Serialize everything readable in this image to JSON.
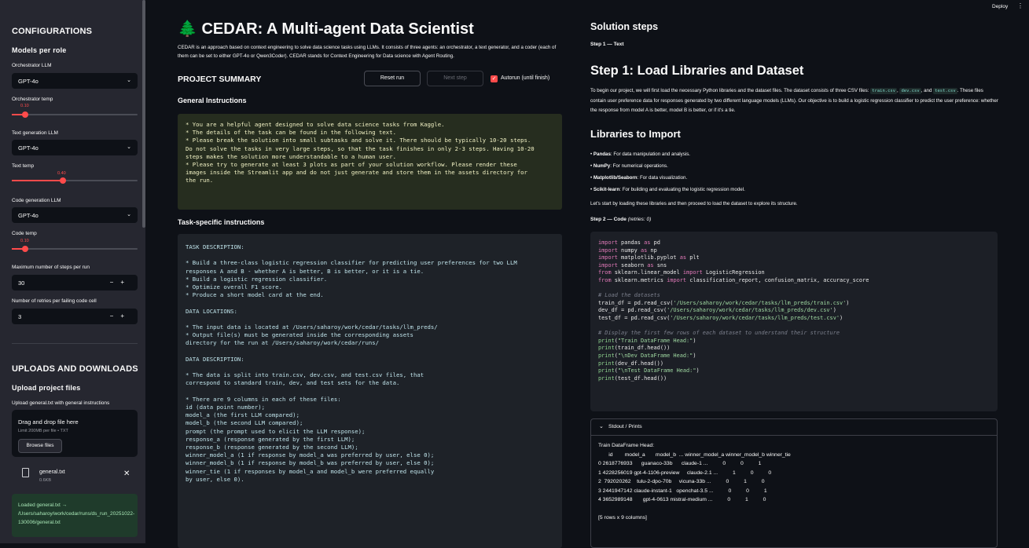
{
  "header": {
    "deploy_label": "Deploy",
    "menu_icon": "kebab-icon"
  },
  "sidebar": {
    "configurations_title": "CONFIGURATIONS",
    "models_title": "Models per role",
    "orch_llm_label": "Orchestrator LLM",
    "orch_llm_value": "GPT-4o",
    "orch_temp_label": "Orchestrator temp",
    "orch_temp_value": "0.10",
    "text_llm_label": "Text generation LLM",
    "text_llm_value": "GPT-4o",
    "text_temp_label": "Text temp",
    "text_temp_value": "0.40",
    "code_llm_label": "Code generation LLM",
    "code_llm_value": "GPT-4o",
    "code_temp_label": "Code temp",
    "code_temp_value": "0.10",
    "max_steps_label": "Maximum number of steps per run",
    "max_steps_value": "30",
    "retries_label": "Number of retries per failing code cell",
    "retries_value": "3",
    "minus": "−",
    "plus": "+",
    "uploads_title": "UPLOADS AND DOWNLOADS",
    "upload_files_title": "Upload project files",
    "upload_general_label": "Upload general.txt with general instructions",
    "drop_title": "Drag and drop file here",
    "drop_limit": "Limit 200MB per file • TXT",
    "browse_label": "Browse files",
    "file_name": "general.txt",
    "file_size": "0.6KB",
    "loaded_msg": "Loaded general.txt → /Users/saharoy/work/cedar/runs/ds_run_20251022-130006/general.txt"
  },
  "main": {
    "title_icon": "🌲",
    "title": "CEDAR: A Multi-agent Data Scientist",
    "description": "CEDAR is an approach based on context engineering to solve data science tasks using LLMs. It consists of three agents: an orchestrator, a text generator, and a coder (each of them can be set to either GPT-4o or Qwen3Coder). CEDAR stands for Context Engineering for Data science with Agent Routing.",
    "project_summary": "PROJECT SUMMARY",
    "reset_label": "Reset run",
    "next_label": "Next step",
    "autorun_label": "Autorun (until finish)",
    "general_title": "General Instructions",
    "general_text": "* You are a helpful agent designed to solve data science tasks from Kaggle.\n* The details of the task can be found in the following text.\n* Please break the solution into small subtasks and solve it. There should be typically 10-20 steps.\nDo not solve the tasks in very large steps, so that the task finishes in only 2-3 steps. Having 10-20\nsteps makes the solution more understandable to a human user.\n* Please try to generate at least 3 plots as part of your solution workflow. Please render these\nimages inside the Streamlit app and do not just generate and store them in the assets directory for\nthe run.",
    "task_title": "Task-specific instructions",
    "task_text": "TASK DESCRIPTION:\n\n* Build a three-class logistic regression classifier for predicting user preferences for two LLM\nresponses A and B - whether A is better, B is better, or it is a tie.\n* Build a logistic regression classifier.\n* Optimize overall F1 score.\n* Produce a short model card at the end.\n\nDATA LOCATIONS:\n\n* The input data is located at /Users/saharoy/work/cedar/tasks/llm_preds/\n* Output file(s) must be generated inside the corresponding assets\ndirectory for the run at /Users/saharoy/work/cedar/runs/\n\nDATA DESCRIPTION:\n\n* The data is split into train.csv, dev.csv, and test.csv files, that\ncorrespond to standard train, dev, and test sets for the data.\n\n* There are 9 columns in each of these files:\nid (data point number);\nmodel_a (the first LLM compared);\nmodel_b (the second LLM compared);\nprompt (the prompt used to elicit the LLM response);\nresponse_a (response generated by the first LLM);\nresponse_b (response generated by the second LLM);\nwinner_model_a (1 if response by model_a was preferred by user, else 0);\nwinner_model_b (1 if response by model_b was preferred by user, else 0);\nwinner_tie (1 if responses by model_a and model_b were preferred equally\nby user, else 0)."
  },
  "solution": {
    "title": "Solution steps",
    "step1_label": "Step 1 — Text",
    "step1_heading": "Step 1: Load Libraries and Dataset",
    "step1_p1a": "To begin our project, we will first load the necessary Python libraries and the dataset files. The dataset consists of three CSV files: ",
    "tag_train": "train.csv",
    "tag_dev": "dev.csv",
    "tag_test": "test.csv",
    "step1_p1b": ". These files contain user preference data for responses generated by two different language models (LLMs). Our objective is to build a logistic regression classifier to predict the user preference: whether the response from model A is better, model B is better, or if it's a tie.",
    "libs_heading": "Libraries to Import",
    "libs": [
      {
        "name": "Pandas",
        "desc": ": For data manipulation and analysis."
      },
      {
        "name": "NumPy",
        "desc": ": For numerical operations."
      },
      {
        "name": "Matplotlib/Seaborn",
        "desc": ": For data visualization."
      },
      {
        "name": "Scikit-learn",
        "desc": ": For building and evaluating the logistic regression model."
      }
    ],
    "start_text": "Let's start by loading these libraries and then proceed to load the dataset to explore its structure.",
    "step2_label": "Step 2 — Code",
    "step2_retries": "(retries: 0)",
    "stdout_label": "Stdout / Prints",
    "stdout_text": "Train DataFrame Head:\n       id        model_a       model_b  ... winner_model_a winner_model_b winner_tie\n0 2618776933      guanaco-33b      claude-1 ...          0          0          1\n1 4228256019 gpt-4-1106-preview     claude-2.1 ...          1          0          0\n2  792020262    tulu-2-dpo-70b     vicuna-33b ...          0          1          0\n3 2441947142 claude-instant-1   openchat-3.5 ...          0          0          1\n4 3652989148       gpt-4-0613 mistral-medium ...          0          1          0\n\n[5 rows x 9 columns]"
  }
}
